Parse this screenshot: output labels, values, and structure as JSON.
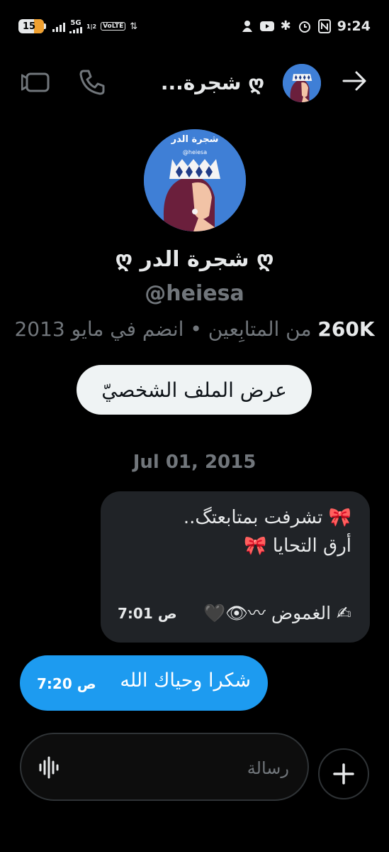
{
  "status_bar": {
    "battery": "15",
    "network": "5G",
    "sim_label": "1|2",
    "volte": "VoLTE",
    "time": "9:24"
  },
  "header": {
    "title": "ღ شجرة...",
    "back_icon": "arrow-right-icon",
    "video_icon": "video-icon",
    "call_icon": "phone-icon"
  },
  "avatar": {
    "banner_text": "شجرة الدر",
    "handle_text": "@heiesa",
    "colors": {
      "bg": "#3f7fd6",
      "hair": "#6b1f3c",
      "skin": "#f2c3a6",
      "crown": "#f4f4f4",
      "diamond": "#1f3c88"
    }
  },
  "profile": {
    "name": "ღ شجرة الدر ღ",
    "handle": "@heiesa",
    "followers_count": "260K",
    "followers_label": "من المتابِعين",
    "separator": "•",
    "joined": "انضم في مايو 2013",
    "view_profile_label": "عرض الملف الشخصيّ"
  },
  "conversation": {
    "date": "Jul 01, 2015",
    "messages": [
      {
        "direction": "in",
        "line1": "🎀 تشرفت بمتابعتگ..",
        "line2": "أرق التحايا 🎀",
        "signature": "✍ الغموض 〰👁🖤",
        "time": "7:01 ص"
      },
      {
        "direction": "out",
        "text": "شكرا وحياك الله",
        "time": "7:20 ص"
      }
    ]
  },
  "composer": {
    "placeholder": "رسالة",
    "voice_icon": "audio-waveform-icon",
    "add_icon": "plus-icon"
  },
  "colors": {
    "background": "#000000",
    "text": "#e7e9ea",
    "muted": "#71767b",
    "bubble_in": "#202327",
    "bubble_out": "#1d9bf0"
  }
}
